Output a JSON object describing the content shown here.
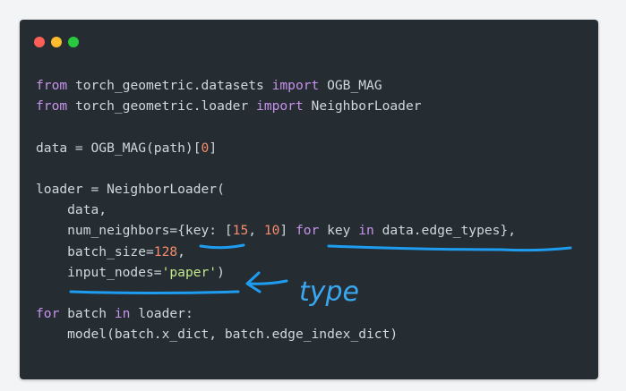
{
  "window": {
    "controls": [
      {
        "name": "close",
        "color": "#ff5f57"
      },
      {
        "name": "minimize",
        "color": "#febc2e"
      },
      {
        "name": "maximize",
        "color": "#28c840"
      }
    ]
  },
  "code": {
    "lines": [
      [
        {
          "t": "from",
          "c": "kw"
        },
        {
          "t": " torch_geometric.datasets "
        },
        {
          "t": "import",
          "c": "kw"
        },
        {
          "t": " OGB_MAG"
        }
      ],
      [
        {
          "t": "from",
          "c": "kw"
        },
        {
          "t": " torch_geometric.loader "
        },
        {
          "t": "import",
          "c": "kw"
        },
        {
          "t": " NeighborLoader"
        }
      ],
      [],
      [
        {
          "t": "data = OGB_MAG(path)["
        },
        {
          "t": "0",
          "c": "num"
        },
        {
          "t": "]"
        }
      ],
      [],
      [
        {
          "t": "loader = NeighborLoader("
        }
      ],
      [
        {
          "t": "    data,"
        }
      ],
      [
        {
          "t": "    num_neighbors={key: ["
        },
        {
          "t": "15",
          "c": "num"
        },
        {
          "t": ", "
        },
        {
          "t": "10",
          "c": "num"
        },
        {
          "t": "] "
        },
        {
          "t": "for",
          "c": "kw"
        },
        {
          "t": " key "
        },
        {
          "t": "in",
          "c": "kw"
        },
        {
          "t": " data.edge_types},"
        }
      ],
      [
        {
          "t": "    batch_size="
        },
        {
          "t": "128",
          "c": "num"
        },
        {
          "t": ","
        }
      ],
      [
        {
          "t": "    input_nodes="
        },
        {
          "t": "'paper'",
          "c": "str"
        },
        {
          "t": ")"
        }
      ],
      [],
      [
        {
          "t": "for",
          "c": "kw"
        },
        {
          "t": " batch "
        },
        {
          "t": "in",
          "c": "kw"
        },
        {
          "t": " loader:"
        }
      ],
      [
        {
          "t": "    model(batch.x_dict, batch.edge_index_dict)"
        }
      ]
    ]
  },
  "annotation": {
    "handwritten_text": "type",
    "color": "#3aa8f0"
  }
}
